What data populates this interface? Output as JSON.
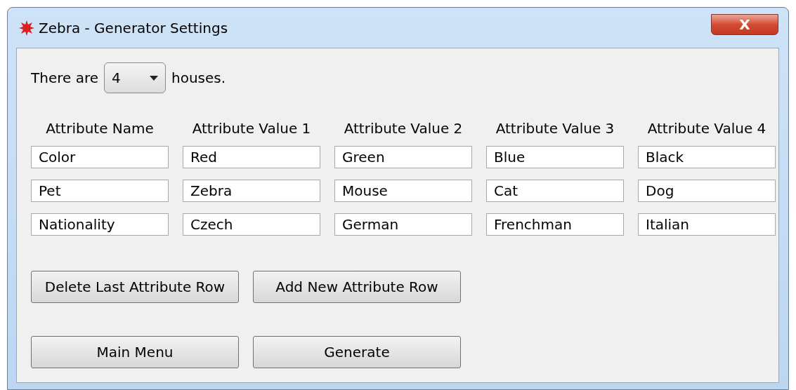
{
  "window": {
    "title": "Zebra - Generator Settings",
    "close": "X"
  },
  "houses": {
    "prefix": "There are",
    "value": "4",
    "suffix": "houses."
  },
  "columns": [
    "Attribute Name",
    "Attribute Value 1",
    "Attribute Value 2",
    "Attribute Value 3",
    "Attribute Value 4"
  ],
  "rows": [
    [
      "Color",
      "Red",
      "Green",
      "Blue",
      "Black"
    ],
    [
      "Pet",
      "Zebra",
      "Mouse",
      "Cat",
      "Dog"
    ],
    [
      "Nationality",
      "Czech",
      "German",
      "Frenchman",
      "Italian"
    ]
  ],
  "row_buttons": [
    "Delete Last Attribute Row",
    "Add New Attribute Row"
  ],
  "main_buttons": [
    "Main Menu",
    "Generate"
  ]
}
